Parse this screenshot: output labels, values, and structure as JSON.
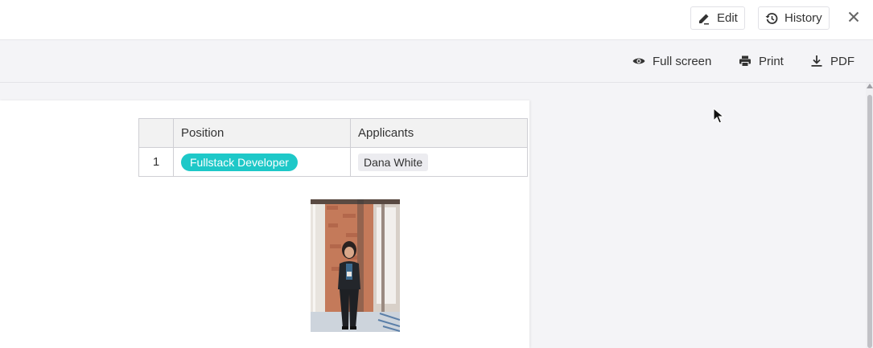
{
  "header": {
    "edit_label": "Edit",
    "history_label": "History"
  },
  "toolbar": {
    "fullscreen_label": "Full screen",
    "print_label": "Print",
    "pdf_label": "PDF"
  },
  "table": {
    "columns": [
      "",
      "Position",
      "Applicants"
    ],
    "rows": [
      {
        "index": "1",
        "position": "Fullstack Developer",
        "applicant": "Dana White"
      }
    ]
  },
  "colors": {
    "accent_pill": "#1ec8c8",
    "applicant_chip": "#ececf0"
  },
  "icons": {
    "edit": "pencil-icon",
    "history": "history-icon",
    "close": "close-icon",
    "fullscreen": "eye-icon",
    "print": "printer-icon",
    "pdf": "download-icon"
  }
}
